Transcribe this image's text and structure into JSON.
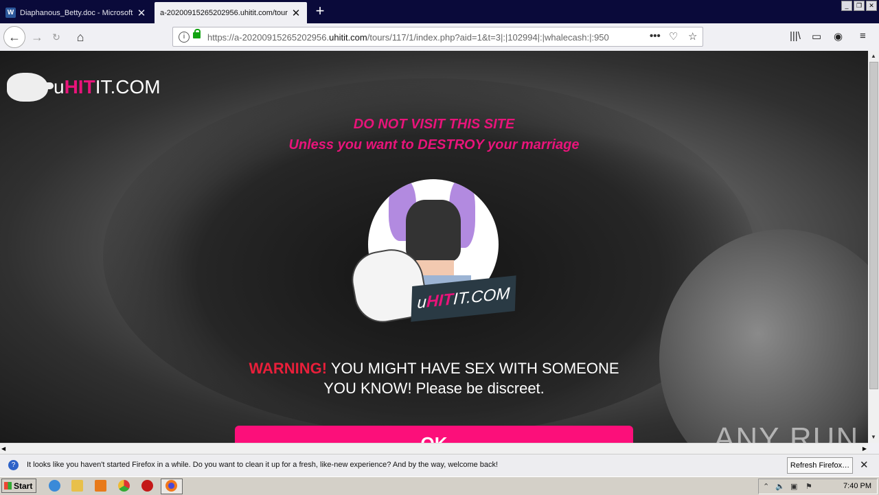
{
  "tabs": [
    {
      "title": "Diaphanous_Betty.doc - Microsoft",
      "icon": "word-icon"
    },
    {
      "title": "a-20200915265202956.uhitit.com/tour"
    }
  ],
  "url": {
    "prefix": "https://a-20200915265202956.",
    "domain": "uhitit.com",
    "path": "/tours/117/1/index.php?aid=1&t=3|:|102994|:|whalecash:|:950"
  },
  "page": {
    "logo": {
      "pre": "u",
      "hit": "HIT",
      "post": "IT.COM"
    },
    "headline1": "DO NOT VISIT THIS SITE",
    "headline2": "Unless you want to DESTROY your marriage",
    "badge": {
      "pre": "u",
      "hit": "HIT",
      "post": "IT.COM"
    },
    "warning_label": "WARNING!",
    "warning_text1": " YOU MIGHT HAVE SEX WITH SOMEONE",
    "warning_text2": "YOU KNOW! Please be discreet.",
    "ok_label": "OK"
  },
  "watermark": "ANY RUN",
  "notification": {
    "message": "It looks like you haven't started Firefox in a while. Do you want to clean it up for a fresh, like-new experience? And by the way, welcome back!",
    "button": "Refresh Firefox…"
  },
  "taskbar": {
    "start": "Start",
    "clock": "7:40 PM"
  },
  "colors": {
    "brand_pink": "#e8147a",
    "button_pink": "#fc0f7a",
    "warning_red": "#e81f3a"
  }
}
